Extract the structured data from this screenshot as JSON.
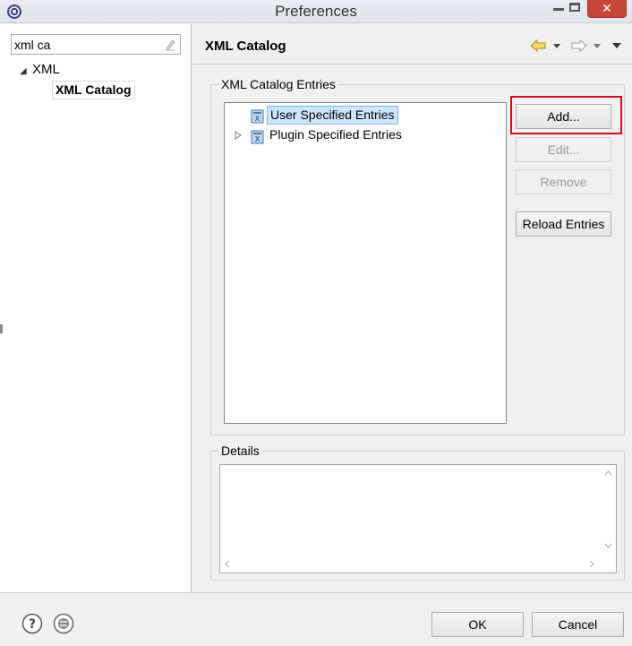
{
  "window": {
    "title": "Preferences",
    "close_glyph": "✕"
  },
  "filter": {
    "value": "xml ca"
  },
  "tree": {
    "items": [
      {
        "label": "XML",
        "expanded": true
      },
      {
        "label": "XML Catalog",
        "selected": true
      }
    ]
  },
  "page": {
    "title": "XML Catalog"
  },
  "entries_group": {
    "legend": "XML Catalog Entries",
    "rows": [
      {
        "label": "User Specified Entries",
        "selected": true
      },
      {
        "label": "Plugin Specified Entries",
        "selected": false
      }
    ]
  },
  "buttons": {
    "add": "Add...",
    "edit": "Edit...",
    "remove": "Remove",
    "reload": "Reload Entries",
    "ok": "OK",
    "cancel": "Cancel"
  },
  "details_group": {
    "legend": "Details"
  },
  "colors": {
    "highlight": "#d0111a",
    "selection": "#cce8ff",
    "close": "#c7463a"
  },
  "icons": [
    "eclipse-app-icon",
    "clear-filter-icon",
    "back-arrow-icon",
    "forward-arrow-icon",
    "view-menu-icon",
    "catalog-icon",
    "help-icon",
    "import-export-icon"
  ]
}
